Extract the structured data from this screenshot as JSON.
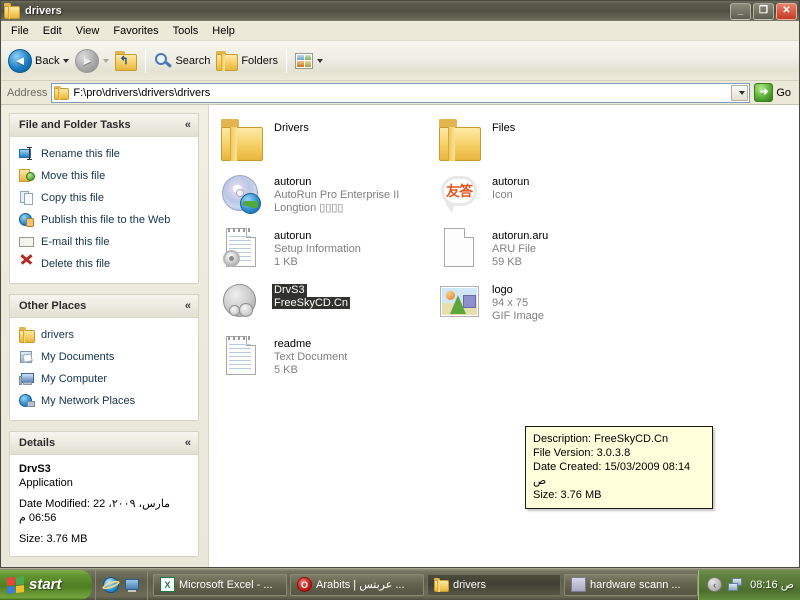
{
  "window": {
    "title": "drivers",
    "icon": "folder-icon",
    "buttons": {
      "minimize": "_",
      "maximize": "❐",
      "close": "✕"
    }
  },
  "menubar": {
    "items": [
      {
        "label": "File"
      },
      {
        "label": "Edit"
      },
      {
        "label": "View"
      },
      {
        "label": "Favorites"
      },
      {
        "label": "Tools"
      },
      {
        "label": "Help"
      }
    ]
  },
  "toolbar": {
    "back_label": "Back",
    "search_label": "Search",
    "folders_label": "Folders",
    "icons": {
      "back": "back-arrow-icon",
      "forward": "forward-arrow-icon",
      "up": "up-folder-icon",
      "search": "magnifier-icon",
      "folders": "folders-icon",
      "views": "views-icon"
    }
  },
  "address": {
    "label": "Address",
    "path": "F:\\pro\\drivers\\drivers\\drivers",
    "go_label": "Go"
  },
  "sidebar": {
    "panels": [
      {
        "title": "File and Folder Tasks",
        "collapse": "«",
        "items": [
          {
            "label": "Rename this file",
            "icon": "rename-icon"
          },
          {
            "label": "Move this file",
            "icon": "move-icon"
          },
          {
            "label": "Copy this file",
            "icon": "copy-icon"
          },
          {
            "label": "Publish this file to the Web",
            "icon": "publish-web-icon"
          },
          {
            "label": "E-mail this file",
            "icon": "email-icon"
          },
          {
            "label": "Delete this file",
            "icon": "delete-icon"
          }
        ]
      },
      {
        "title": "Other Places",
        "collapse": "«",
        "items": [
          {
            "label": "drivers",
            "icon": "folder-icon"
          },
          {
            "label": "My Documents",
            "icon": "my-documents-icon"
          },
          {
            "label": "My Computer",
            "icon": "my-computer-icon"
          },
          {
            "label": "My Network Places",
            "icon": "network-places-icon"
          }
        ]
      }
    ],
    "details": {
      "title": "Details",
      "collapse": "«",
      "name": "DrvS3",
      "type": "Application",
      "date_modified": "Date Modified: 22 مارس، ٢٠٠٩، 06:56 م",
      "size": "Size: 3.76 MB"
    }
  },
  "filelist": {
    "items": [
      {
        "name": "Drivers",
        "meta1": "",
        "meta2": "",
        "icon": "folder-icon",
        "selected": false
      },
      {
        "name": "Files",
        "meta1": "",
        "meta2": "",
        "icon": "folder-icon",
        "selected": false
      },
      {
        "name": "autorun",
        "meta1": "AutoRun Pro Enterprise II",
        "meta2": "Longtion ▯▯▯▯",
        "icon": "cd-autorun-icon",
        "selected": false
      },
      {
        "name": "autorun",
        "meta1": "Icon",
        "meta2": "",
        "icon": "speech-bubble-icon",
        "selected": false
      },
      {
        "name": "autorun",
        "meta1": "Setup Information",
        "meta2": "1 KB",
        "icon": "setup-information-icon",
        "selected": false
      },
      {
        "name": "autorun.aru",
        "meta1": "ARU File",
        "meta2": "59 KB",
        "icon": "blank-file-icon",
        "selected": false
      },
      {
        "name": "DrvS3",
        "meta1": "FreeSkyCD.Cn",
        "meta2": "",
        "icon": "application-icon",
        "selected": true
      },
      {
        "name": "logo",
        "meta1": "94 x 75",
        "meta2": "GIF Image",
        "icon": "image-icon",
        "selected": false
      },
      {
        "name": "readme",
        "meta1": "Text Document",
        "meta2": "5 KB",
        "icon": "text-document-icon",
        "selected": false
      }
    ]
  },
  "tooltip": {
    "lines": [
      "Description: FreeSkyCD.Cn",
      "File Version: 3.0.3.8",
      "Date Created: 15/03/2009 08:14 ص",
      "Size: 3.76 MB"
    ]
  },
  "taskbar": {
    "start_label": "start",
    "quicklaunch": [
      {
        "name": "internet-explorer-icon"
      },
      {
        "name": "show-desktop-icon"
      }
    ],
    "tasks": [
      {
        "label": "Microsoft Excel - ...",
        "icon": "excel-icon",
        "active": false
      },
      {
        "label": "Arabits | عربتس ...",
        "icon": "opera-icon",
        "active": false
      },
      {
        "label": "drivers",
        "icon": "folder-icon",
        "active": true
      },
      {
        "label": "hardware scann ...",
        "icon": "hardware-scan-icon",
        "active": false
      }
    ],
    "tray": {
      "chevron": "‹",
      "network_icon": "network-icon",
      "clock": "08:16 ص"
    }
  },
  "colors": {
    "titlebar": "#4f4f42",
    "selection": "#31312e",
    "tooltip_bg": "#ffffdc",
    "taskbar": "#5e5e4c",
    "start_green": "#4f7d22",
    "desktop": "#5a8a3c"
  }
}
